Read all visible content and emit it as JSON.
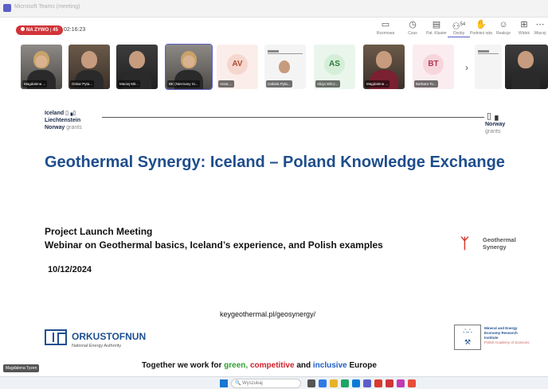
{
  "window": {
    "title": "Microsoft Teams (meeting)"
  },
  "meeting": {
    "recording_label": "NA ZYWO",
    "recording_count": "45",
    "elapsed_time": "02:16:23",
    "controls": [
      {
        "label": "Rozmowa",
        "icon": "chat-icon"
      },
      {
        "label": "Czas",
        "icon": "clock-icon"
      },
      {
        "label": "Pat. Klaster",
        "icon": "react-icon"
      },
      {
        "label": "Osoby",
        "icon": "people-icon",
        "count": "54"
      },
      {
        "label": "Podnieś rękę",
        "icon": "raise-hand-icon"
      },
      {
        "label": "Reakcje",
        "icon": "emoji-icon"
      },
      {
        "label": "Widok",
        "icon": "view-icon"
      },
      {
        "label": "Więcej",
        "icon": "more-icon"
      }
    ]
  },
  "participants": [
    {
      "name": "Magdalena ...",
      "type": "video",
      "style": "light"
    },
    {
      "name": "Oskar Pyta...",
      "type": "video",
      "style": "warm"
    },
    {
      "name": "Maciej Mir...",
      "type": "video",
      "style": "dark"
    },
    {
      "name": "BK (Nieznany Si...",
      "type": "video",
      "style": "light",
      "active": true
    },
    {
      "name": "Anna ...",
      "type": "avatar",
      "initials": "AV",
      "bg": "#f6d7cf",
      "fg": "#b24a37"
    },
    {
      "name": "Izabela Pyta...",
      "type": "slide"
    },
    {
      "name": "Alicja Wilcz...",
      "type": "avatar",
      "initials": "AS",
      "bg": "#d5eed8",
      "fg": "#2f7a3b"
    },
    {
      "name": "Magdalena ...",
      "type": "video",
      "style": "warm"
    },
    {
      "name": "Barbara To...",
      "type": "avatar",
      "initials": "BT",
      "bg": "#f7d5dc",
      "fg": "#b03a55"
    },
    {
      "name": "",
      "type": "slide"
    },
    {
      "name": "",
      "type": "video",
      "style": "dark"
    }
  ],
  "slide": {
    "logo_left": {
      "line1": "Iceland",
      "line2": "Liechtenstein",
      "line3a": "Norway",
      "line3b": "grants"
    },
    "logo_right": {
      "line1": "Norway",
      "line2": "grants"
    },
    "title": "Geothermal Synergy: Iceland – Poland Knowledge Exchange",
    "subtitle_1": "Project Launch Meeting",
    "subtitle_2": "Webinar on Geothermal basics, Iceland’s experience, and Polish examples",
    "geo_logo": {
      "line1": "Geothermal",
      "line2": "Synergy"
    },
    "date": "10/12/2024",
    "link": "keygeothermal.pl/geosynergy/",
    "orkustofnun": {
      "name": "ORKUSTOFNUN",
      "sub": "National Energy Authority"
    },
    "merri": {
      "line1": "Mineral and Energy",
      "line2": "Economy Research",
      "line3": "Institute",
      "line4": "Polish Academy of Sciences"
    },
    "footer": {
      "part1": "Together we work for",
      "green": "green,",
      "red": "competitive",
      "part2": "and",
      "blue": "inclusive",
      "part3": "Europe"
    }
  },
  "self_view": {
    "name": "Magdalena Tyzen"
  },
  "taskbar": {
    "search_placeholder": "Wyszukaj"
  },
  "colors": {
    "accent": "#5b5fc7",
    "title_blue": "#1e4d8c",
    "record_red": "#d13438"
  }
}
